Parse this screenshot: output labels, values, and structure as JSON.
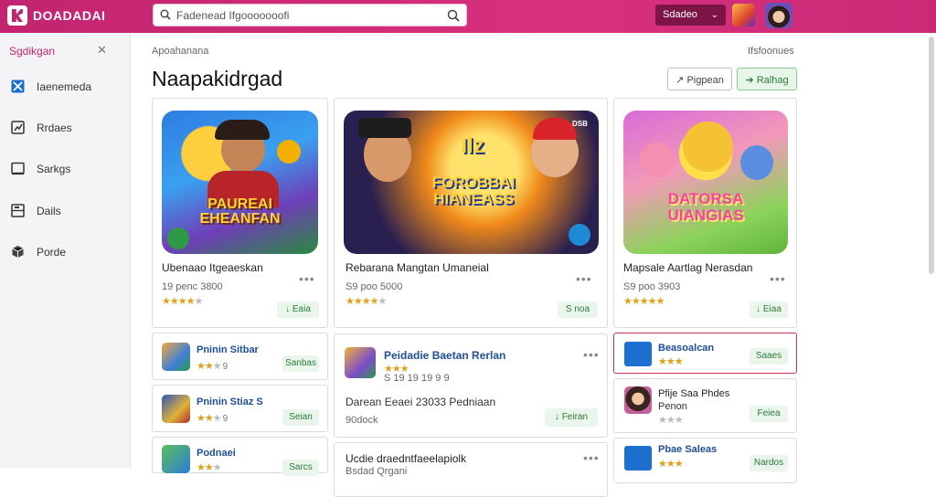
{
  "app": {
    "title": "DOADADAI"
  },
  "search": {
    "placeholder": "Fadenead Ifgooooooofi"
  },
  "account": {
    "label": "Sdadeo"
  },
  "sidebar": {
    "title": "Sgdikgan",
    "items": [
      {
        "label": "Iaenemeda",
        "icon": "x-square-icon"
      },
      {
        "label": "Rrdaes",
        "icon": "chart-icon"
      },
      {
        "label": "Sarkgs",
        "icon": "square-icon"
      },
      {
        "label": "Dails",
        "icon": "drawer-icon"
      },
      {
        "label": "Porde",
        "icon": "box-icon"
      }
    ]
  },
  "main": {
    "breadcrumb": "Apoahanana",
    "right_link": "Ifsfoonues",
    "page_title": "Naapakidrgad",
    "btn_outline": "Pigpean",
    "btn_green": "Ralhag"
  },
  "featured": [
    {
      "title": "Ubenaao Itgeaeskan",
      "meta": "19 penc 3800",
      "stars": "★★★★",
      "stars_off": "★",
      "action": "Eaia",
      "art_text": "PAUREAI EHEANFAN"
    },
    {
      "title": "Rebarana Mangtan Umaneial",
      "meta": "S9 poo 5000",
      "stars": "★★★★",
      "stars_off": "★",
      "action": "S noa",
      "art_text": "FOROBBAI HIANEASS",
      "art_corner": "DSB",
      "art_top": "Ilz"
    },
    {
      "title": "Mapsale Aartlag Nerasdan",
      "meta": "S9 poo 3903",
      "stars": "★★★★★",
      "stars_off": "",
      "action": "Eiaa",
      "art_text": "DATORSA UIANGIAS"
    }
  ],
  "list_left": [
    {
      "title": "Pninin Sitbar",
      "stars": "★★",
      "stars_off": "★",
      "rating": "9",
      "action": "Sanbas"
    },
    {
      "title": "Pninin Stiaz S",
      "stars": "★★",
      "stars_off": "★",
      "rating": "9",
      "action": "Seian"
    },
    {
      "title": "Podnaei",
      "stars": "★★",
      "stars_off": "★",
      "rating": "",
      "action": "Sarcs"
    }
  ],
  "list_mid": {
    "item": {
      "title": "Peidadie Baetan Rerlan",
      "stars": "★★★",
      "meta": "S 19 19 19 9 9"
    },
    "line1": "Darean Eeaei 23033 Pedniaan",
    "line2": "90dock",
    "action": "Feiran",
    "line3": "Ucdie draedntfaeelapiolk",
    "line4": "Bsdad Qrgani"
  },
  "list_right": [
    {
      "title": "Beasoalcan",
      "stars": "★★★",
      "action": "Saaes",
      "highlight": true
    },
    {
      "title": "Pfije Saa Phdes",
      "sub": "Penon",
      "stars_off": "★★★",
      "action": "Feiea"
    },
    {
      "title": "Pbae Saleas",
      "stars": "★★★",
      "action": "Nardos"
    }
  ],
  "colors": {
    "brand": "#c2246f",
    "accent_green": "#2a7a3a",
    "link_blue": "#1f4e99",
    "star": "#e0a018"
  }
}
